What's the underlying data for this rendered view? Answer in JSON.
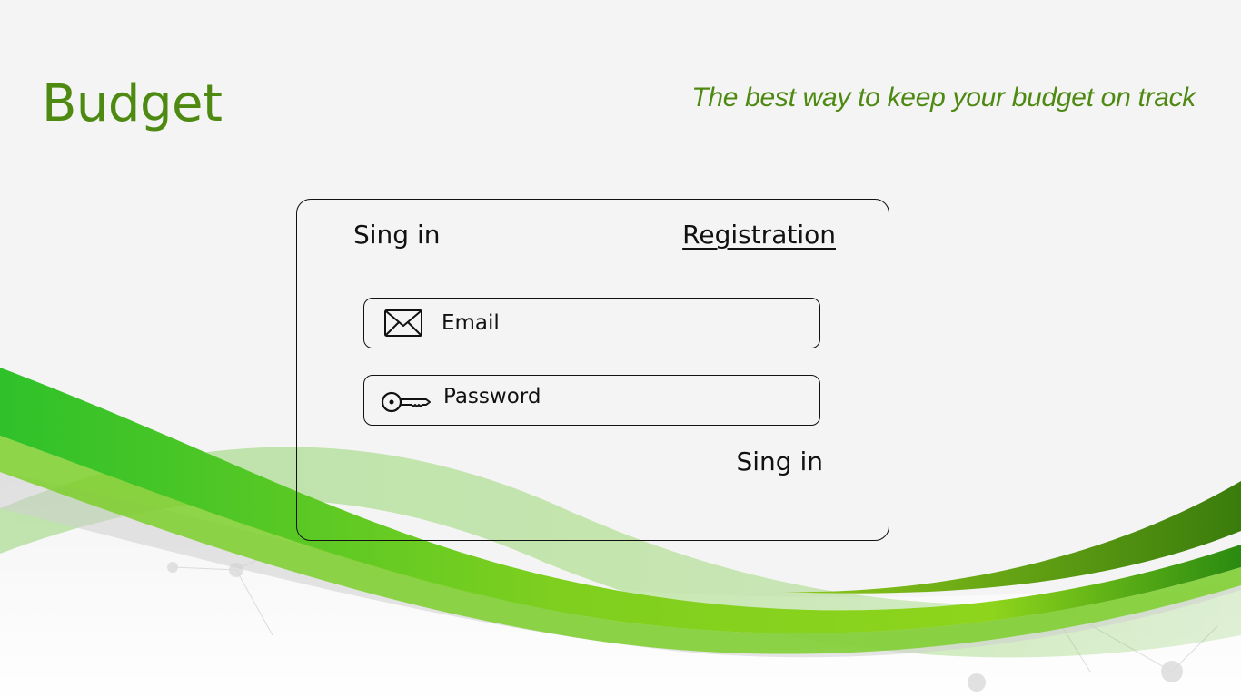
{
  "header": {
    "title": "Budget",
    "tagline": "The best way to keep your budget on track"
  },
  "auth": {
    "tabs": {
      "signin": "Sing in",
      "registration": "Registration"
    },
    "email": {
      "placeholder": "Email",
      "icon": "envelope-icon"
    },
    "password": {
      "placeholder": "Password",
      "icon": "key-icon"
    },
    "submit_label": "Sing in"
  },
  "colors": {
    "brand": "#4e8a12",
    "background": "#f4f4f4",
    "wave_primary": "#4cc422",
    "wave_dark": "#3e7f0c"
  }
}
